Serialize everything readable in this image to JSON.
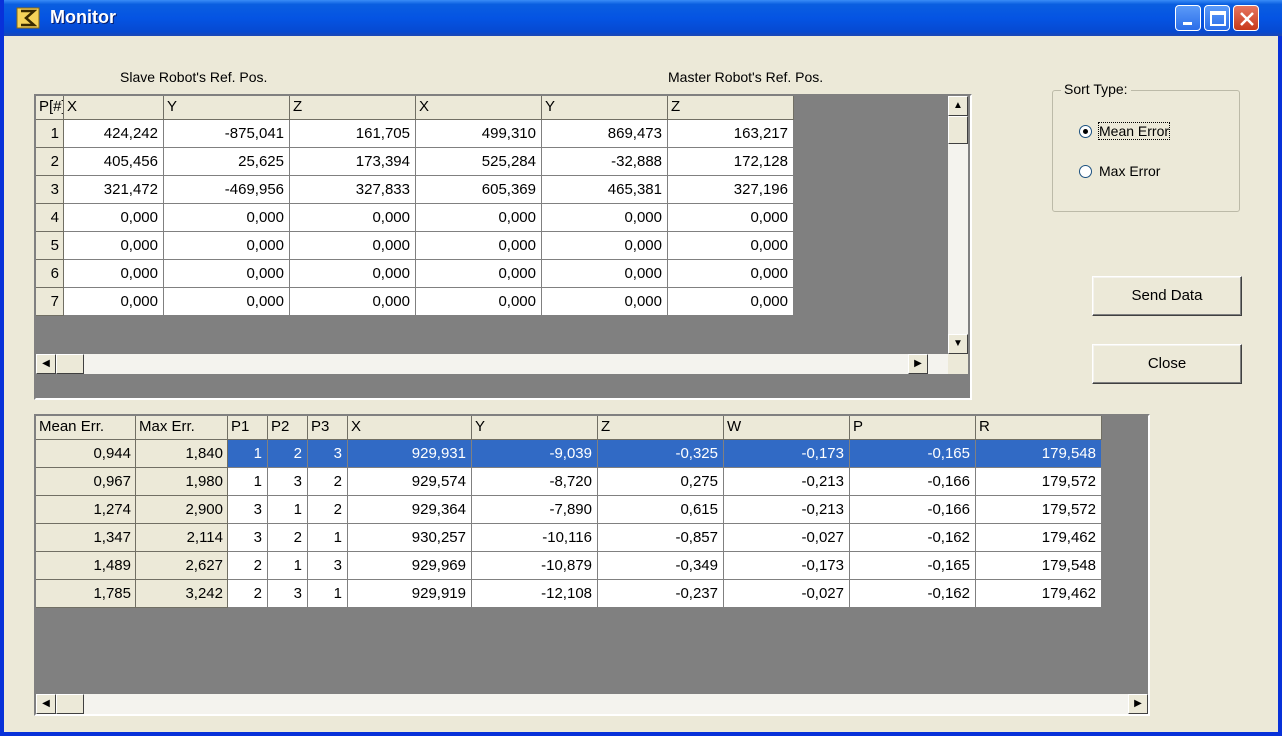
{
  "window": {
    "title": "Monitor"
  },
  "labels": {
    "slave": "Slave Robot's Ref. Pos.",
    "master": "Master Robot's Ref. Pos."
  },
  "top_grid": {
    "headers": [
      "P[#]",
      "X",
      "Y",
      "Z",
      "X",
      "Y",
      "Z"
    ],
    "rows": [
      [
        "1",
        "424,242",
        "-875,041",
        "161,705",
        "499,310",
        "869,473",
        "163,217"
      ],
      [
        "2",
        "405,456",
        "25,625",
        "173,394",
        "525,284",
        "-32,888",
        "172,128"
      ],
      [
        "3",
        "321,472",
        "-469,956",
        "327,833",
        "605,369",
        "465,381",
        "327,196"
      ],
      [
        "4",
        "0,000",
        "0,000",
        "0,000",
        "0,000",
        "0,000",
        "0,000"
      ],
      [
        "5",
        "0,000",
        "0,000",
        "0,000",
        "0,000",
        "0,000",
        "0,000"
      ],
      [
        "6",
        "0,000",
        "0,000",
        "0,000",
        "0,000",
        "0,000",
        "0,000"
      ],
      [
        "7",
        "0,000",
        "0,000",
        "0,000",
        "0,000",
        "0,000",
        "0,000"
      ]
    ]
  },
  "bottom_grid": {
    "headers": [
      "Mean Err.",
      "Max Err.",
      "P1",
      "P2",
      "P3",
      "X",
      "Y",
      "Z",
      "W",
      "P",
      "R"
    ],
    "selected_row": 0,
    "rows": [
      [
        "0,944",
        "1,840",
        "1",
        "2",
        "3",
        "929,931",
        "-9,039",
        "-0,325",
        "-0,173",
        "-0,165",
        "179,548"
      ],
      [
        "0,967",
        "1,980",
        "1",
        "3",
        "2",
        "929,574",
        "-8,720",
        "0,275",
        "-0,213",
        "-0,166",
        "179,572"
      ],
      [
        "1,274",
        "2,900",
        "3",
        "1",
        "2",
        "929,364",
        "-7,890",
        "0,615",
        "-0,213",
        "-0,166",
        "179,572"
      ],
      [
        "1,347",
        "2,114",
        "3",
        "2",
        "1",
        "930,257",
        "-10,116",
        "-0,857",
        "-0,027",
        "-0,162",
        "179,462"
      ],
      [
        "1,489",
        "2,627",
        "2",
        "1",
        "3",
        "929,969",
        "-10,879",
        "-0,349",
        "-0,173",
        "-0,165",
        "179,548"
      ],
      [
        "1,785",
        "3,242",
        "2",
        "3",
        "1",
        "929,919",
        "-12,108",
        "-0,237",
        "-0,027",
        "-0,162",
        "179,462"
      ]
    ]
  },
  "sort_type": {
    "label": "Sort Type:",
    "options": [
      "Mean Error",
      "Max Error"
    ],
    "selected": "Mean Error"
  },
  "buttons": {
    "send": "Send Data",
    "close": "Close"
  },
  "colors": {
    "selection": "#316ac5",
    "titlebar": "#0554e3",
    "face": "#ece9d8"
  }
}
